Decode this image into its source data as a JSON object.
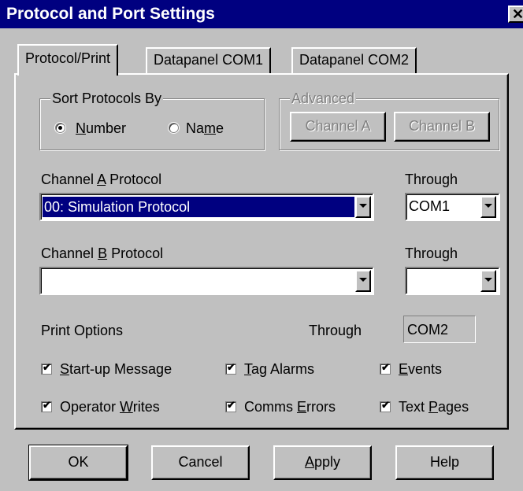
{
  "window": {
    "title": "Protocol and Port Settings",
    "close_glyph": "✕"
  },
  "tabs": [
    {
      "label": "Protocol/Print",
      "active": true
    },
    {
      "label": "Datapanel COM1",
      "active": false
    },
    {
      "label": "Datapanel COM2",
      "active": false
    }
  ],
  "sort_group": {
    "legend": "Sort Protocols By",
    "options": [
      {
        "label_pre": "",
        "label_u": "N",
        "label_post": "umber",
        "selected": true
      },
      {
        "label_pre": "Na",
        "label_u": "m",
        "label_post": "e",
        "selected": false
      }
    ]
  },
  "advanced_group": {
    "legend": "Advanced",
    "channel_a": "Channel A",
    "channel_b": "Channel B"
  },
  "channel_a": {
    "label_pre": "Channel ",
    "label_u": "A",
    "label_post": " Protocol",
    "value": "00: Simulation Protocol",
    "through_label": "Through",
    "through_value": "COM1"
  },
  "channel_b": {
    "label_pre": "Channel ",
    "label_u": "B",
    "label_post": " Protocol",
    "value": "",
    "through_label": "Through",
    "through_value": ""
  },
  "print": {
    "label": "Print Options",
    "through_label": "Through",
    "through_value": "COM2"
  },
  "checkboxes": [
    {
      "pre": "",
      "u": "S",
      "post": "tart-up Message",
      "checked": true
    },
    {
      "pre": "",
      "u": "T",
      "post": "ag Alarms",
      "checked": true
    },
    {
      "pre": "",
      "u": "E",
      "post": "vents",
      "checked": true
    },
    {
      "pre": "Operator ",
      "u": "W",
      "post": "rites",
      "checked": true
    },
    {
      "pre": "Comms ",
      "u": "E",
      "post": "rrors",
      "checked": true
    },
    {
      "pre": "Text ",
      "u": "P",
      "post": "ages",
      "checked": true
    }
  ],
  "check_glyph": "✔",
  "buttons": {
    "ok": "OK",
    "cancel": "Cancel",
    "apply_u": "A",
    "apply_post": "pply",
    "help": "Help"
  }
}
